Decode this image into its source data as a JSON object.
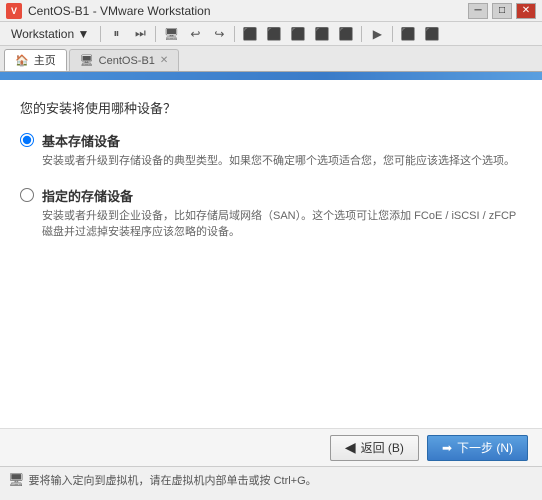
{
  "titlebar": {
    "icon_label": "V",
    "title": "CentOS-B1 - VMware Workstation",
    "btn_minimize": "─",
    "btn_maximize": "□",
    "btn_close": "✕"
  },
  "menubar": {
    "workstation_label": "Workstation ▼",
    "toolbar_icons": [
      "⏸",
      "⏭",
      "🖥",
      "↩",
      "↪",
      "⏭",
      "⏹",
      "⏹⏹",
      "▶",
      "⏶"
    ]
  },
  "tabs": {
    "home_label": "主页",
    "vm_tab_label": "CentOS-B1"
  },
  "progress_banner": {
    "width_percent": 75
  },
  "content": {
    "question": "您的安装将使用哪种设备？",
    "option1_title": "基本存储设备",
    "option1_desc": "安装或者升级到存储设备的典型类型。如果您不确定哪个选项适合您，您可能应该选择这个选项。",
    "option2_title": "指定的存储设备",
    "option2_desc": "安装或者升级到企业设备，比如存储局域网络（SAN）。这个选项可让您添加 FCoE / iSCSI / zFCP 磁盘并过滤掉安装程序应该忽略的设备。"
  },
  "nav": {
    "back_label": "返回 (B)",
    "next_label": "下一步 (N)",
    "back_icon": "◀",
    "next_icon": "▶"
  },
  "statusbar": {
    "text": "要将输入定向到虚拟机，请在虚拟机内部单击或按 Ctrl+G。",
    "icon": "🖥"
  }
}
